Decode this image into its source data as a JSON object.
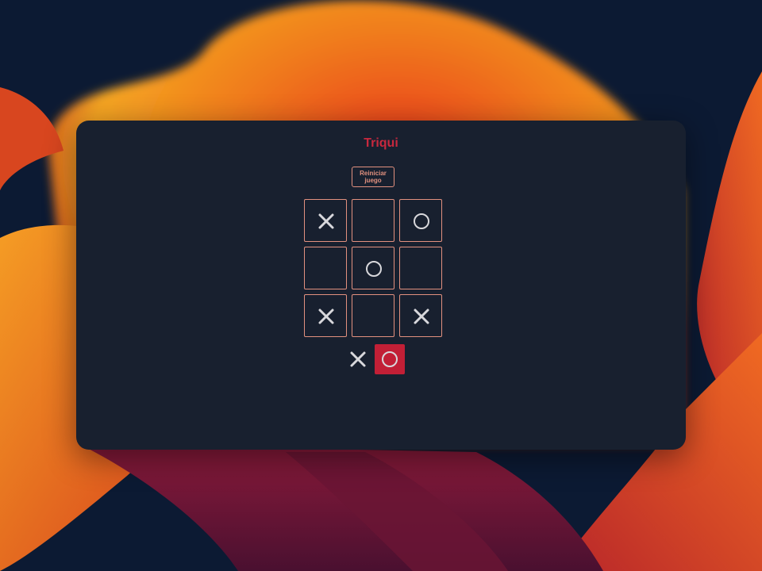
{
  "window": {
    "title": "Triqui",
    "reset_label": "Reiniciar juego"
  },
  "board": {
    "cells": [
      "x",
      "",
      "o",
      "",
      "o",
      "",
      "x",
      "",
      "x"
    ]
  },
  "turn": {
    "symbols": [
      "x",
      "o"
    ],
    "active": "o"
  },
  "colors": {
    "title": "#c8283e",
    "cell_border": "#e2917f",
    "mark": "#d8d8dc",
    "active_turn_bg": "#c21f36",
    "window_bg": "#18202f"
  },
  "icons": {
    "x": "x-mark-icon",
    "o": "o-mark-icon"
  }
}
